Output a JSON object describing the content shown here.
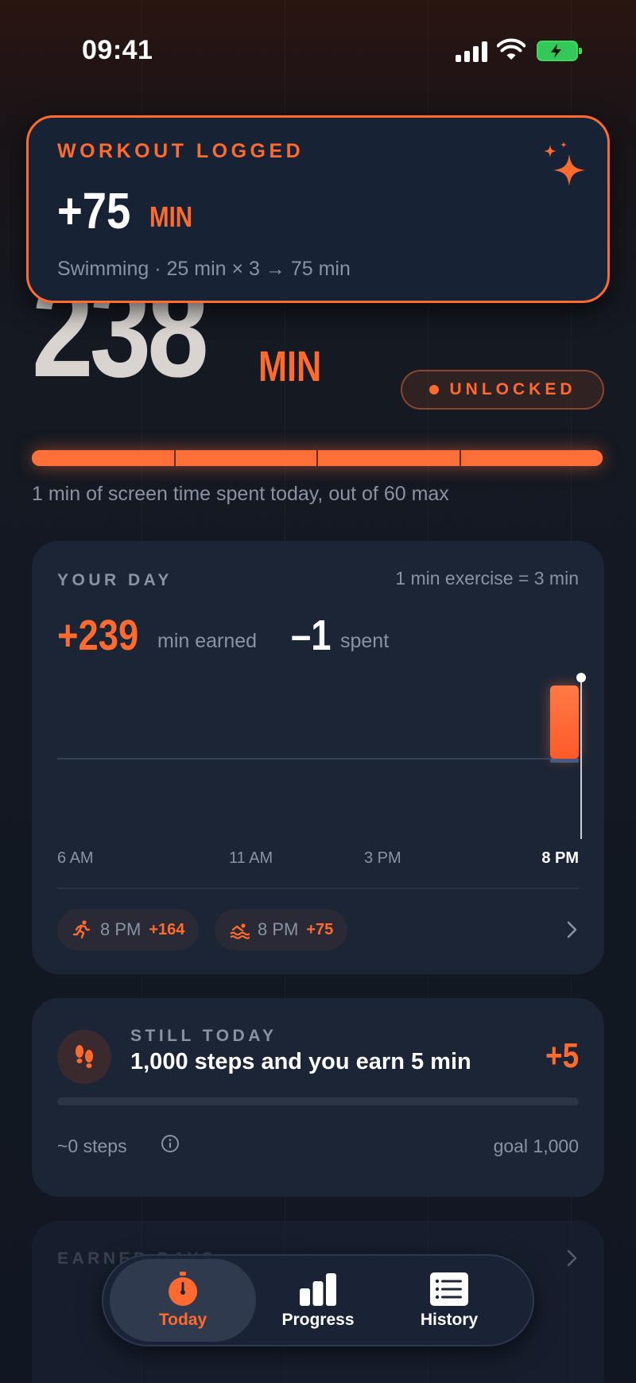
{
  "status_bar": {
    "time": "09:41"
  },
  "hero": {
    "balance": "238",
    "balance_unit": "MIN",
    "state": "UNLOCKED",
    "progress_fraction": 1.0,
    "progress_caption": "1 min of screen time spent today, out of 60 max"
  },
  "toast": {
    "label": "WORKOUT LOGGED",
    "value": "+75",
    "unit": "MIN",
    "detail": "Swimming · 25 min × 3 → 75 min"
  },
  "your_day": {
    "title": "YOUR DAY",
    "rate": "1 min exercise = 3 min",
    "earned_value": "+239",
    "earned_label": "min earned",
    "spent_value": "–1",
    "spent_label": "spent",
    "ticks": [
      "6 AM",
      "11 AM",
      "3 PM",
      "8 PM"
    ],
    "activities": [
      {
        "icon": "running-icon",
        "time": "8 PM",
        "value": "+164"
      },
      {
        "icon": "swimming-icon",
        "time": "8 PM",
        "value": "+75"
      }
    ]
  },
  "steps": {
    "title": "STILL TODAY",
    "headline": "1,000 steps and you earn 5 min",
    "reward": "+5",
    "progress_fraction": 0.0,
    "count": "~0 steps",
    "goal": "goal 1,000"
  },
  "earned_days": {
    "title": "EARNED DAYS"
  },
  "tabbar": {
    "tabs": [
      {
        "label": "Today",
        "icon": "stopwatch-icon",
        "active": true
      },
      {
        "label": "Progress",
        "icon": "bar-chart-icon",
        "active": false
      },
      {
        "label": "History",
        "icon": "list-icon",
        "active": false
      }
    ]
  },
  "colors": {
    "accent": "#ff6a2f",
    "card": "#1b2536",
    "muted": "#8a93a3",
    "background": "#111722",
    "battery": "#34c759"
  }
}
